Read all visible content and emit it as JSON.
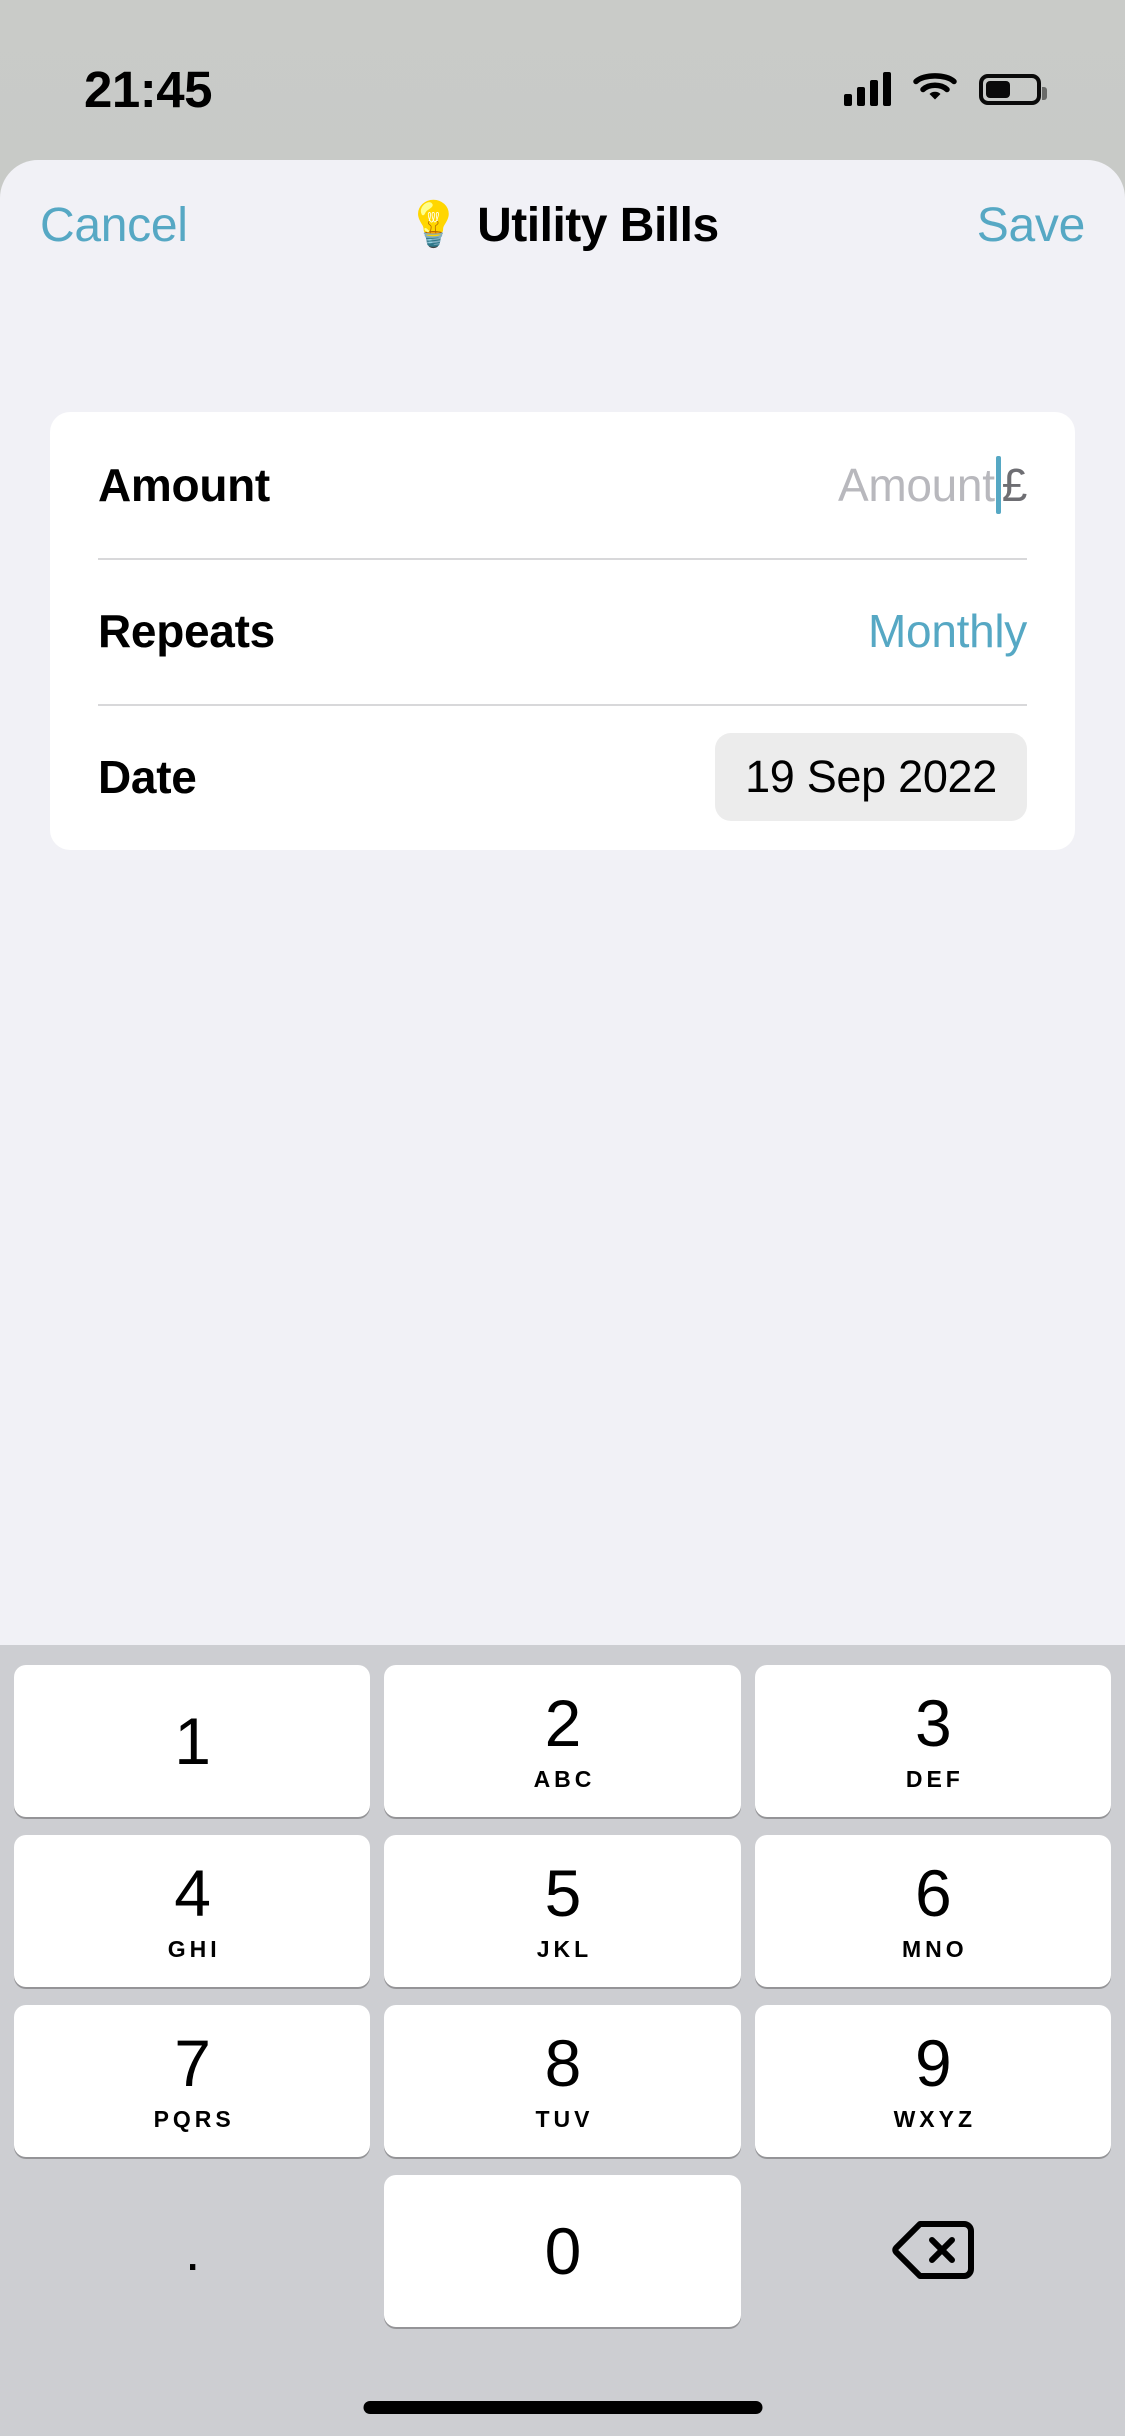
{
  "status_bar": {
    "time": "21:45",
    "signal_icon": "cellular-signal-icon",
    "wifi_icon": "wifi-icon",
    "battery_icon": "battery-icon",
    "battery_level_percent": 45
  },
  "nav_bar": {
    "cancel_label": "Cancel",
    "title_emoji": "💡",
    "title": "Utility Bills",
    "save_label": "Save"
  },
  "form": {
    "rows": [
      {
        "label": "Amount",
        "placeholder": "Amount",
        "value": "",
        "currency_symbol": "£",
        "focused": true
      },
      {
        "label": "Repeats",
        "value": "Monthly"
      },
      {
        "label": "Date",
        "value": "19 Sep 2022"
      }
    ]
  },
  "keyboard": {
    "type": "numeric-decimal-pad",
    "keys": [
      {
        "digit": "1",
        "letters": ""
      },
      {
        "digit": "2",
        "letters": "ABC"
      },
      {
        "digit": "3",
        "letters": "DEF"
      },
      {
        "digit": "4",
        "letters": "GHI"
      },
      {
        "digit": "5",
        "letters": "JKL"
      },
      {
        "digit": "6",
        "letters": "MNO"
      },
      {
        "digit": "7",
        "letters": "PQRS"
      },
      {
        "digit": "8",
        "letters": "TUV"
      },
      {
        "digit": "9",
        "letters": "WXYZ"
      },
      {
        "digit": ".",
        "letters": ""
      },
      {
        "digit": "0",
        "letters": ""
      },
      {
        "digit": "",
        "letters": "",
        "icon": "backspace-icon"
      }
    ]
  },
  "colors": {
    "accent": "#56a8c4",
    "sheet_background": "#f1f1f6",
    "card_background": "#ffffff",
    "keyboard_background": "#cdced2",
    "backdrop": "#c4c6c3",
    "placeholder_text": "#b8b8bd",
    "date_pill_background": "#ececec"
  },
  "home_indicator": "home-indicator"
}
